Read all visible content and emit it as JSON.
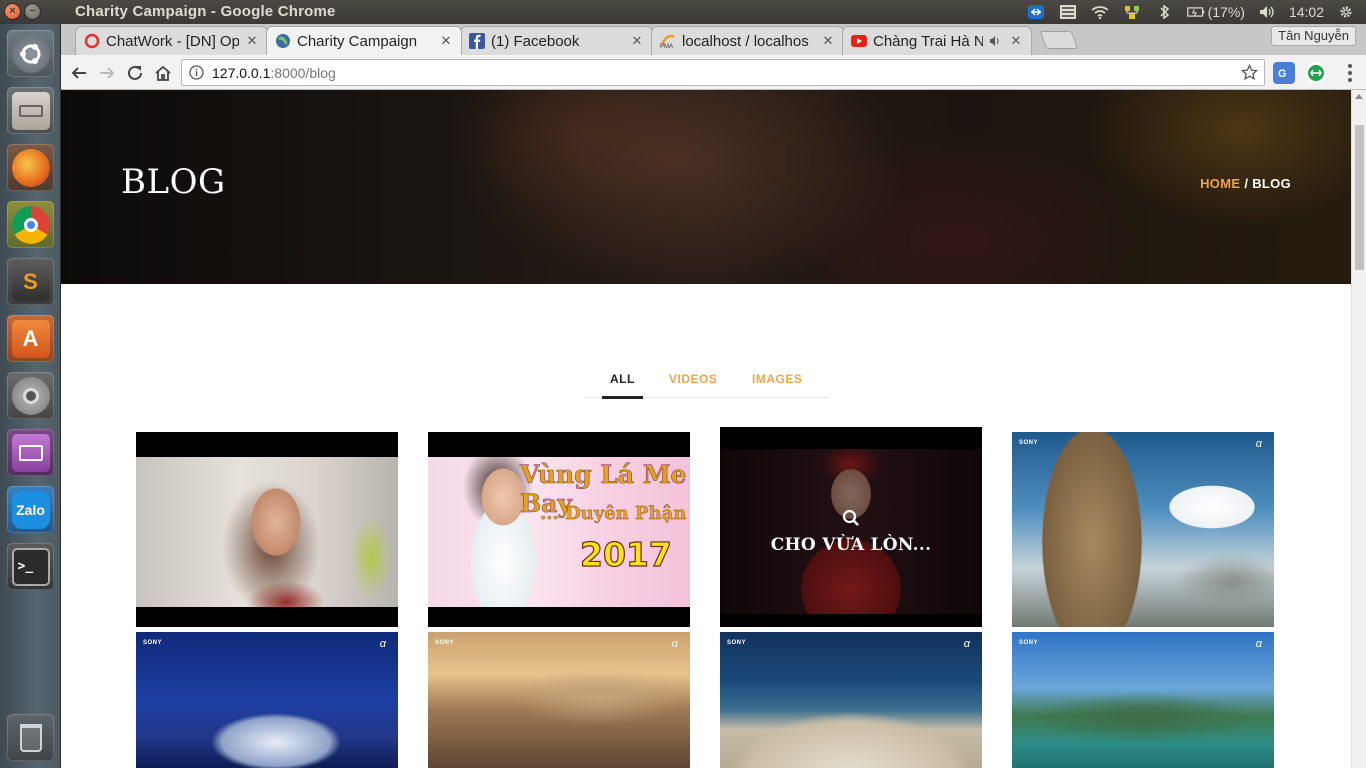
{
  "os": {
    "window_title": "Charity Campaign - Google Chrome",
    "tray": {
      "battery": "(17%)",
      "time": "14:02"
    },
    "launcher": [
      {
        "name": "ubuntu-dash-icon"
      },
      {
        "name": "files-icon"
      },
      {
        "name": "firefox-icon"
      },
      {
        "name": "chrome-icon"
      },
      {
        "name": "sublime-text-icon",
        "glyph": "S"
      },
      {
        "name": "software-center-icon",
        "glyph": "A"
      },
      {
        "name": "system-settings-icon"
      },
      {
        "name": "app-icon"
      },
      {
        "name": "zalo-icon",
        "glyph": "Zalo"
      },
      {
        "name": "terminal-icon",
        "glyph": ">_"
      },
      {
        "name": "trash-icon"
      }
    ]
  },
  "browser": {
    "tabs": [
      {
        "title": "ChatWork - [DN] Op",
        "favicon": "chatwork-icon",
        "active": false
      },
      {
        "title": "Charity Campaign",
        "favicon": "globe-icon",
        "active": true
      },
      {
        "title": "(1) Facebook",
        "favicon": "facebook-icon",
        "active": false
      },
      {
        "title": "localhost / localhos",
        "favicon": "phpmyadmin-icon",
        "active": false
      },
      {
        "title": "Chàng Trai Hà N",
        "favicon": "youtube-icon",
        "active": false
      }
    ],
    "profile_name": "Tân Nguyễn",
    "url_host": "127.0.0.1",
    "url_path": ":8000/blog"
  },
  "page": {
    "hero_title": "BLOG",
    "breadcrumb": {
      "home": "HOME",
      "separator": "/",
      "current": "BLOG"
    },
    "filters": {
      "all": "ALL",
      "videos": "VIDEOS",
      "images": "IMAGES"
    },
    "tiles": {
      "video2_title_line1": "Vùng Lá Me Bay",
      "video2_title_line2": "... Duyên Phận",
      "video2_year": "2017",
      "hover_caption": "CHO VỪA LÒN...",
      "sony": "SONY",
      "alpha": "α"
    }
  },
  "colors": {
    "accent": "#f0a44b",
    "hero_text": "#ffffff",
    "active_filter": "#222222"
  }
}
